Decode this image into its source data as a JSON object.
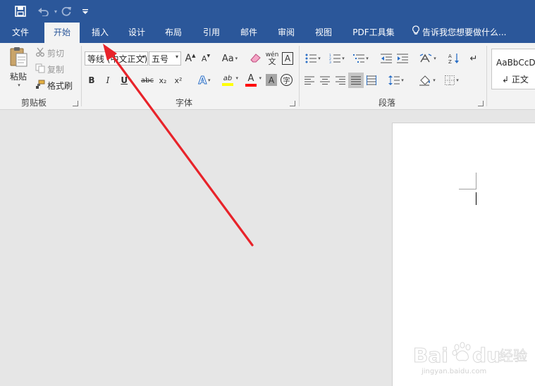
{
  "qat": {
    "save_icon": "save-icon",
    "undo_icon": "undo-icon",
    "redo_icon": "redo-icon",
    "customize_icon": "customize-icon"
  },
  "tabs": [
    {
      "label": "文件"
    },
    {
      "label": "开始",
      "active": true
    },
    {
      "label": "插入"
    },
    {
      "label": "设计"
    },
    {
      "label": "布局"
    },
    {
      "label": "引用"
    },
    {
      "label": "邮件"
    },
    {
      "label": "审阅"
    },
    {
      "label": "视图"
    },
    {
      "label": "PDF工具集"
    }
  ],
  "tellme": {
    "text": "告诉我您想要做什么..."
  },
  "clipboard": {
    "paste": "粘贴",
    "cut": "剪切",
    "copy": "复制",
    "format_painter": "格式刷",
    "group_label": "剪贴板"
  },
  "font": {
    "font_name": "等线 (中文正文)",
    "font_size": "五号",
    "grow_label": "A",
    "shrink_label": "A",
    "case_label": "Aa",
    "phonetic_label": "wén文",
    "border_char_label": "A",
    "bold": "B",
    "italic": "I",
    "underline": "U",
    "strike": "abc",
    "subscript": "x₂",
    "superscript": "x²",
    "effects": "A",
    "highlight": "ab",
    "font_color": "A",
    "shading": "A",
    "enclose": "字",
    "group_label": "字体"
  },
  "paragraph": {
    "group_label": "段落"
  },
  "styles": {
    "sample": "AaBbCcD",
    "name": "↲ 正文"
  },
  "colors": {
    "brand": "#2b579a",
    "ribbon": "#f3f3f3",
    "workspace": "#e6e6e6",
    "arrow": "#e8232a",
    "highlight_bar": "#ffff00",
    "font_color_bar": "#ff0000"
  },
  "watermark": {
    "brand": "Baidu经验",
    "url": "jingyan.baidu.com"
  }
}
